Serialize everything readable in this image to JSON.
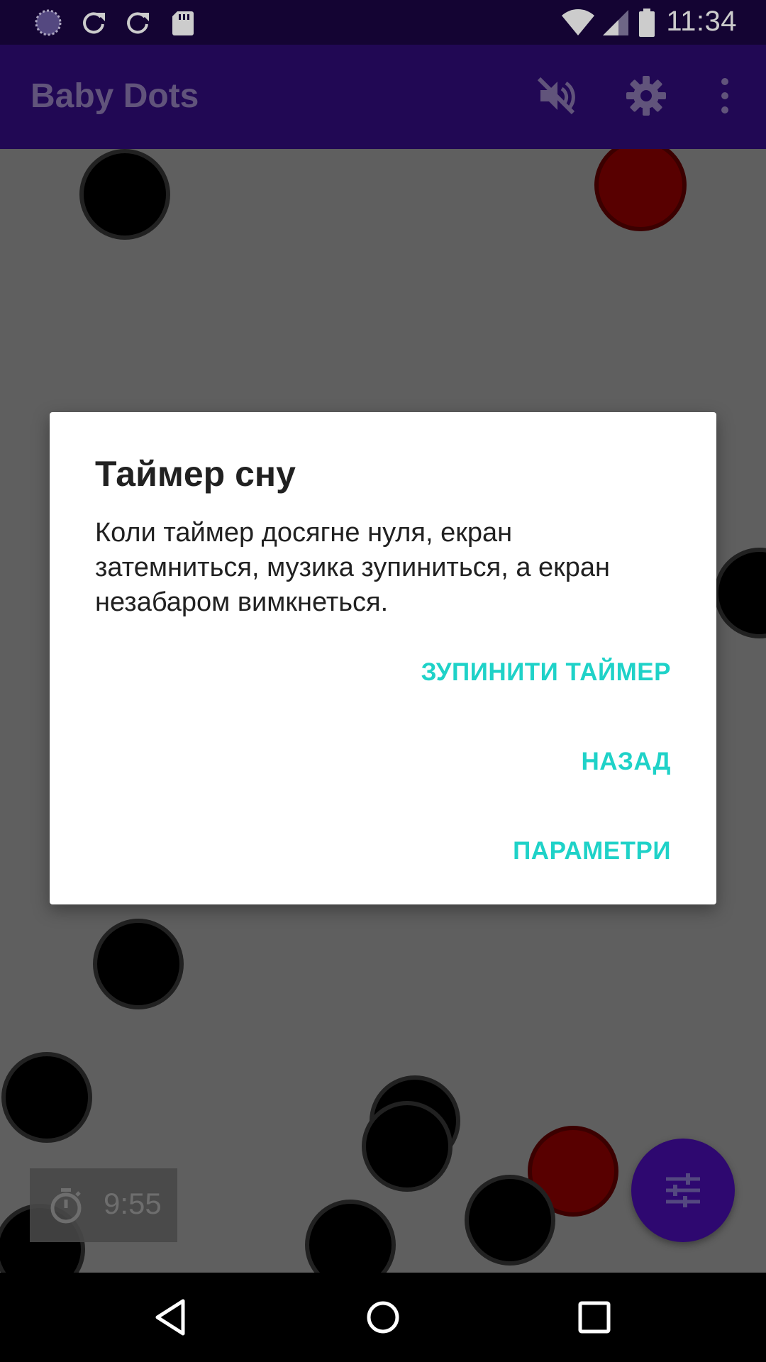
{
  "status_bar": {
    "time": "11:34",
    "left_icons": [
      "loading-icon",
      "sync-icon",
      "sync-icon",
      "sd-card-icon"
    ],
    "right_icons": [
      "wifi-icon",
      "signal-icon",
      "battery-icon"
    ]
  },
  "app_bar": {
    "title": "Baby Dots",
    "actions": [
      "volume-off-icon",
      "settings-icon",
      "more-vert-icon"
    ]
  },
  "timer": {
    "icon": "stopwatch-icon",
    "value": "9:55"
  },
  "fab": {
    "icon": "tune-icon"
  },
  "dialog": {
    "title": "Таймер сну",
    "message": "Коли таймер досягне нуля, екран затемниться, музика зупиниться, а екран незабаром вимкнеться.",
    "buttons": {
      "stop": "ЗУПИНИТИ ТАЙМЕР",
      "back": "НАЗАД",
      "settings": "ПАРАМЕТРИ"
    }
  },
  "nav_bar": {
    "icons": [
      "back-icon",
      "home-icon",
      "recents-icon"
    ]
  },
  "colors": {
    "status_bar": "#1a0640",
    "app_bar": "#2a0a6a",
    "accent": "#1fd2c8",
    "fab": "#3a0a8c",
    "background": "#777777",
    "dot_black": "#000000",
    "dot_red": "#6e0000"
  }
}
